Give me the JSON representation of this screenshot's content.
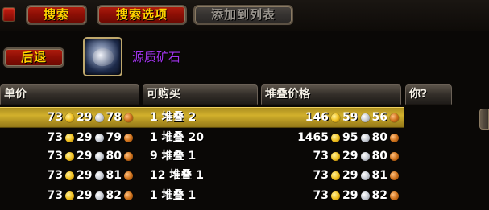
{
  "toolbar": {
    "search_label": "搜索",
    "search_options_label": "搜索选项",
    "add_to_list_label": "添加到列表",
    "back_label": "后退"
  },
  "item": {
    "name": "源质矿石",
    "icon": "ore-icon",
    "name_color": "#a335ee"
  },
  "columns": [
    "单价",
    "可购买",
    "堆叠价格",
    "你?"
  ],
  "colors": {
    "gold": "#f0c020",
    "silver": "#c8ccd4",
    "copper": "#d0731c",
    "selected_row": "#d2b02c"
  },
  "rows": [
    {
      "unit": {
        "g": "73",
        "s": "29",
        "c": "78"
      },
      "qty": "1",
      "stack_word": "堆叠",
      "stack": "2",
      "total": {
        "g": "146",
        "s": "59",
        "c": "56"
      },
      "selected": true
    },
    {
      "unit": {
        "g": "73",
        "s": "29",
        "c": "79"
      },
      "qty": "1",
      "stack_word": "堆叠",
      "stack": "20",
      "total": {
        "g": "1465",
        "s": "95",
        "c": "80"
      },
      "selected": false
    },
    {
      "unit": {
        "g": "73",
        "s": "29",
        "c": "80"
      },
      "qty": "9",
      "stack_word": "堆叠",
      "stack": "1",
      "total": {
        "g": "73",
        "s": "29",
        "c": "80"
      },
      "selected": false
    },
    {
      "unit": {
        "g": "73",
        "s": "29",
        "c": "81"
      },
      "qty": "12",
      "stack_word": "堆叠",
      "stack": "1",
      "total": {
        "g": "73",
        "s": "29",
        "c": "81"
      },
      "selected": false
    },
    {
      "unit": {
        "g": "73",
        "s": "29",
        "c": "82"
      },
      "qty": "1",
      "stack_word": "堆叠",
      "stack": "1",
      "total": {
        "g": "73",
        "s": "29",
        "c": "82"
      },
      "selected": false
    }
  ]
}
